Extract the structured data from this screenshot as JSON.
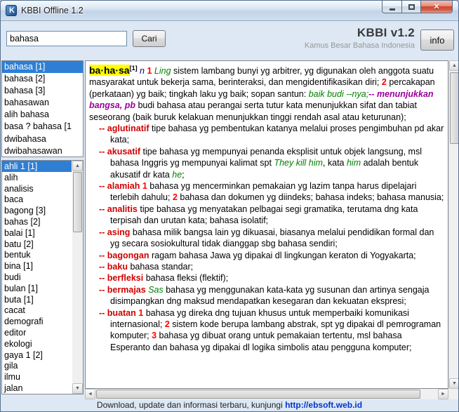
{
  "titlebar": {
    "title": "KBBI Offline 1.2"
  },
  "header": {
    "search": {
      "value": "bahasa"
    },
    "search_button": "Cari",
    "app_title": "KBBI v1.2",
    "app_subtitle": "Kamus Besar Bahasa Indonesia",
    "info_button": "info"
  },
  "sidebar": {
    "primary_list": [
      {
        "label": "bahasa [1]",
        "selected": true
      },
      {
        "label": "bahasa [2]"
      },
      {
        "label": "bahasa [3]"
      },
      {
        "label": "bahasawan"
      },
      {
        "label": "alih bahasa"
      },
      {
        "label": "basa ? bahasa [1"
      },
      {
        "label": "dwibahasa"
      },
      {
        "label": "dwibahasawan"
      }
    ],
    "secondary_list": [
      {
        "label": "ahli 1 [1]",
        "selected": true
      },
      {
        "label": "alih"
      },
      {
        "label": "analisis"
      },
      {
        "label": "baca"
      },
      {
        "label": "bagong [3]"
      },
      {
        "label": "bahas [2]"
      },
      {
        "label": "balai [1]"
      },
      {
        "label": "batu [2]"
      },
      {
        "label": "bentuk"
      },
      {
        "label": "bina [1]"
      },
      {
        "label": "budi"
      },
      {
        "label": "bulan [1]"
      },
      {
        "label": "buta [1]"
      },
      {
        "label": "cacat"
      },
      {
        "label": "demografi"
      },
      {
        "label": "editor"
      },
      {
        "label": "ekologi"
      },
      {
        "label": "gaya 1 [2]"
      },
      {
        "label": "gila"
      },
      {
        "label": "ilmu"
      },
      {
        "label": "jalan"
      }
    ]
  },
  "content": {
    "paragraphs": [
      {
        "sub": false,
        "segments": [
          {
            "style": "headword",
            "text": "ba·ha·sa"
          },
          {
            "style": "sup",
            "text": "[1]"
          },
          {
            "style": "pos",
            "text": " n "
          },
          {
            "style": "num",
            "text": "1 "
          },
          {
            "style": "label",
            "text": "Ling "
          },
          {
            "style": "plain",
            "text": "sistem lambang bunyi yg arbitrer, yg digunakan oleh anggota suatu masyarakat untuk bekerja sama, berinteraksi, dan mengidentifikasikan diri; "
          },
          {
            "style": "num",
            "text": "2 "
          },
          {
            "style": "plain",
            "text": "percakapan (perkataan) yg baik; tingkah laku yg baik; sopan santun: "
          },
          {
            "style": "example",
            "text": "baik budi --nya;"
          },
          {
            "style": "proverb",
            "text": "-- menunjukkan bangsa, pb "
          },
          {
            "style": "plain",
            "text": "budi bahasa atau perangai serta tutur kata menunjukkan sifat dan tabiat seseorang (baik buruk kelakuan menunjukkan tinggi rendah asal atau keturunan);"
          }
        ]
      },
      {
        "sub": true,
        "segments": [
          {
            "style": "subhead",
            "text": "-- aglutinatif"
          },
          {
            "style": "plain",
            "text": " tipe bahasa yg pembentukan katanya melalui proses pengimbuhan pd akar kata;"
          }
        ]
      },
      {
        "sub": true,
        "segments": [
          {
            "style": "subhead",
            "text": "-- akusatif"
          },
          {
            "style": "plain",
            "text": " tipe bahasa yg mempunyai penanda eksplisit untuk objek langsung, msl bahasa Inggris yg mempunyai kalimat spt "
          },
          {
            "style": "example",
            "text": "They kill him"
          },
          {
            "style": "plain",
            "text": ", kata "
          },
          {
            "style": "example",
            "text": "him"
          },
          {
            "style": "plain",
            "text": " adalah bentuk akusatif dr kata "
          },
          {
            "style": "example",
            "text": "he"
          },
          {
            "style": "plain",
            "text": ";"
          }
        ]
      },
      {
        "sub": true,
        "segments": [
          {
            "style": "subhead",
            "text": "-- alamiah"
          },
          {
            "style": "plain",
            "text": " "
          },
          {
            "style": "num",
            "text": "1 "
          },
          {
            "style": "plain",
            "text": "bahasa yg mencerminkan pemakaian yg lazim tanpa harus dipelajari terlebih dahulu; "
          },
          {
            "style": "num",
            "text": "2 "
          },
          {
            "style": "plain",
            "text": "bahasa dan dokumen yg diindeks; bahasa indeks; bahasa manusia;"
          }
        ]
      },
      {
        "sub": true,
        "segments": [
          {
            "style": "subhead",
            "text": "-- analitis"
          },
          {
            "style": "plain",
            "text": " tipe bahasa yg menyatakan pelbagai segi gramatika, terutama dng kata terpisah dan urutan kata; bahasa isolatif;"
          }
        ]
      },
      {
        "sub": true,
        "segments": [
          {
            "style": "subhead",
            "text": "-- asing"
          },
          {
            "style": "plain",
            "text": " bahasa milik bangsa lain yg dikuasai, biasanya melalui pendidikan formal dan yg secara sosiokultural tidak dianggap sbg bahasa sendiri;"
          }
        ]
      },
      {
        "sub": true,
        "segments": [
          {
            "style": "subhead",
            "text": "-- bagongan"
          },
          {
            "style": "plain",
            "text": " ragam bahasa Jawa yg dipakai dl lingkungan keraton di Yogyakarta;"
          }
        ]
      },
      {
        "sub": true,
        "segments": [
          {
            "style": "subhead",
            "text": "-- baku"
          },
          {
            "style": "plain",
            "text": " bahasa standar;"
          }
        ]
      },
      {
        "sub": true,
        "segments": [
          {
            "style": "subhead",
            "text": "-- berfleksi"
          },
          {
            "style": "plain",
            "text": " bahasa fleksi (flektif);"
          }
        ]
      },
      {
        "sub": true,
        "segments": [
          {
            "style": "subhead",
            "text": "-- bermajas"
          },
          {
            "style": "plain",
            "text": " "
          },
          {
            "style": "label",
            "text": "Sas "
          },
          {
            "style": "plain",
            "text": "bahasa yg menggunakan kata-kata yg susunan dan artinya sengaja disimpangkan dng maksud mendapatkan kesegaran dan kekuatan ekspresi;"
          }
        ]
      },
      {
        "sub": true,
        "segments": [
          {
            "style": "subhead",
            "text": "-- buatan"
          },
          {
            "style": "plain",
            "text": " "
          },
          {
            "style": "num",
            "text": "1 "
          },
          {
            "style": "plain",
            "text": "bahasa yg direka dng tujuan khusus untuk memperbaiki komunikasi internasional; "
          },
          {
            "style": "num",
            "text": "2 "
          },
          {
            "style": "plain",
            "text": "sistem kode berupa lambang abstrak, spt yg dipakai dl pemrograman komputer; "
          },
          {
            "style": "num",
            "text": "3 "
          },
          {
            "style": "plain",
            "text": "bahasa yg dibuat orang untuk pemakaian tertentu, msl bahasa Esperanto dan bahasa yg dipakai dl logika simbolis atau pengguna komputer;"
          }
        ]
      }
    ]
  },
  "footer": {
    "text": "Download, update dan informasi terbaru, kunjungi ",
    "link": "http://ebsoft.web.id"
  },
  "icons": {
    "scroll_up": "▲",
    "scroll_down": "▼",
    "scroll_left": "◄",
    "scroll_right": "►",
    "close": "✕"
  },
  "colors": {
    "selection": "#2e7fd4",
    "headword_highlight": "#ffff00",
    "number": "#ff0000",
    "subentry": "#d00000",
    "label_green": "#008000",
    "proverb_purple": "#990099",
    "pos_blue": "#00008b",
    "link_blue": "#0033cc"
  }
}
